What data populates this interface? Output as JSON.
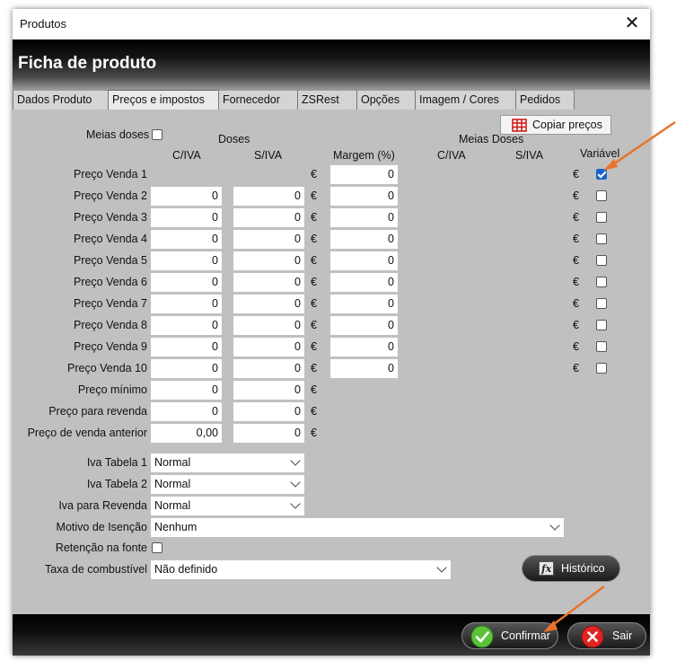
{
  "window": {
    "title": "Produtos",
    "close": "✕"
  },
  "header": {
    "title": "Ficha de produto"
  },
  "tabs": [
    "Dados Produto",
    "Preços e impostos",
    "Fornecedor",
    "ZSRest",
    "Opções",
    "Imagem / Cores",
    "Pedidos"
  ],
  "actions": {
    "copy_prices": "Copiar preços",
    "history": "Histórico",
    "confirm": "Confirmar",
    "exit": "Sair"
  },
  "labels": {
    "meias_doses": "Meias doses",
    "doses": "Doses",
    "meias_doses_hdr": "Meias Doses",
    "civa": "C/IVA",
    "siva": "S/IVA",
    "margem": "Margem (%)",
    "civa2": "C/IVA",
    "siva2": "S/IVA",
    "variavel": "Variável",
    "currency": "€"
  },
  "price_rows": [
    {
      "label": "Preço Venda 1",
      "civa": "",
      "siva": "",
      "margem": "0",
      "variavel": true
    },
    {
      "label": "Preço Venda 2",
      "civa": "0",
      "siva": "0",
      "margem": "0",
      "variavel": false
    },
    {
      "label": "Preço Venda 3",
      "civa": "0",
      "siva": "0",
      "margem": "0",
      "variavel": false
    },
    {
      "label": "Preço Venda 4",
      "civa": "0",
      "siva": "0",
      "margem": "0",
      "variavel": false
    },
    {
      "label": "Preço Venda 5",
      "civa": "0",
      "siva": "0",
      "margem": "0",
      "variavel": false
    },
    {
      "label": "Preço Venda 6",
      "civa": "0",
      "siva": "0",
      "margem": "0",
      "variavel": false
    },
    {
      "label": "Preço Venda 7",
      "civa": "0",
      "siva": "0",
      "margem": "0",
      "variavel": false
    },
    {
      "label": "Preço Venda 8",
      "civa": "0",
      "siva": "0",
      "margem": "0",
      "variavel": false
    },
    {
      "label": "Preço Venda 9",
      "civa": "0",
      "siva": "0",
      "margem": "0",
      "variavel": false
    },
    {
      "label": "Preço Venda 10",
      "civa": "0",
      "siva": "0",
      "margem": "0",
      "variavel": false
    }
  ],
  "extra_rows": [
    {
      "label": "Preço mínimo",
      "civa": "0",
      "siva": "0"
    },
    {
      "label": "Preço para revenda",
      "civa": "0",
      "siva": "0"
    },
    {
      "label": "Preço de venda anterior",
      "civa": "0,00",
      "siva": "0"
    }
  ],
  "tax": {
    "iva1_label": "Iva Tabela 1",
    "iva1_value": "Normal",
    "iva2_label": "Iva Tabela 2",
    "iva2_value": "Normal",
    "ivar_label": "Iva para Revenda",
    "ivar_value": "Normal",
    "isencao_label": "Motivo de Isenção",
    "isencao_value": "Nenhum",
    "retencao_label": "Retenção na fonte",
    "combustivel_label": "Taxa de combustível",
    "combustivel_value": "Não definido"
  },
  "colors": {
    "accent": "#1b63c9",
    "annotation_arrow": "#e8732a",
    "confirm_icon": "#5cc23a",
    "exit_icon": "#e02424"
  }
}
